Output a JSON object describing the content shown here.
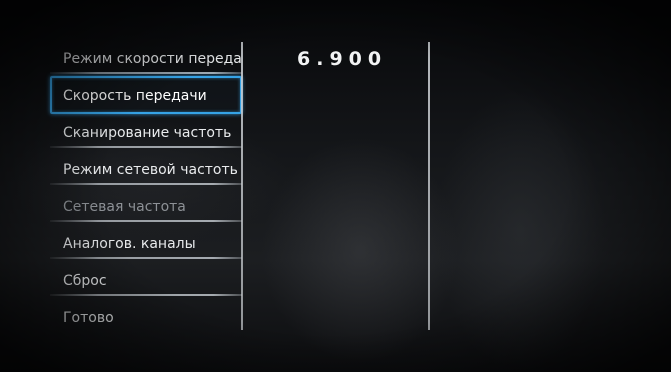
{
  "menu": {
    "items": [
      {
        "label": "Режим скорости переда",
        "state": "normal"
      },
      {
        "label": "Скорость передачи",
        "state": "selected"
      },
      {
        "label": "Сканирование частоть",
        "state": "normal"
      },
      {
        "label": "Режим сетевой частоть",
        "state": "normal"
      },
      {
        "label": "Сетевая частота",
        "state": "disabled"
      },
      {
        "label": "Аналогов. каналы",
        "state": "normal"
      },
      {
        "label": "Сброс",
        "state": "normal"
      },
      {
        "label": "Готово",
        "state": "normal"
      }
    ]
  },
  "detail": {
    "value": "6.900"
  },
  "colors": {
    "selection": "#36a3e6",
    "text": "#e9ebed",
    "disabled_text": "#8d9196"
  }
}
